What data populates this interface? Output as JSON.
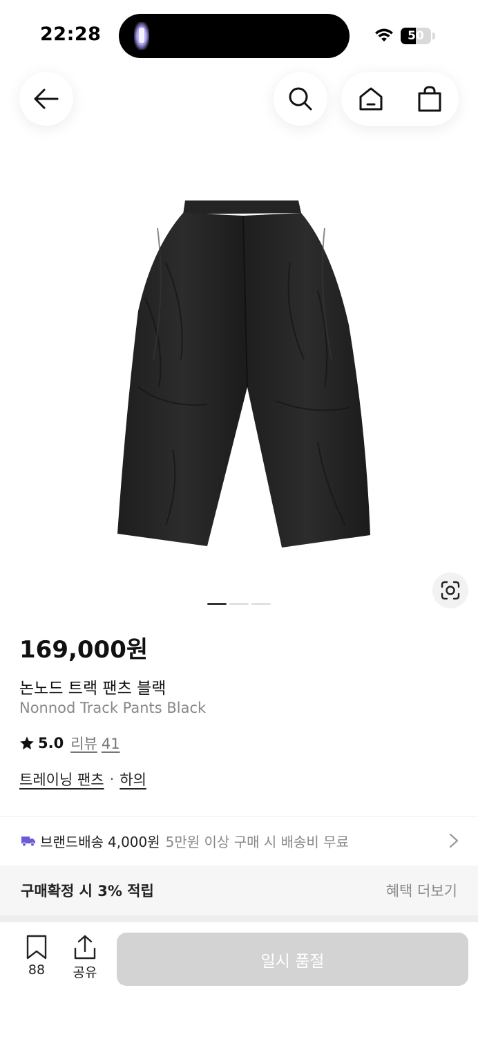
{
  "status_bar": {
    "time": "22:28",
    "battery_percent": "50",
    "battery_level": 0.5
  },
  "nav": {
    "back_icon": "arrow-left-icon",
    "search_icon": "search-icon",
    "home_icon": "home-icon",
    "cart_icon": "shopping-bag-icon"
  },
  "gallery": {
    "image_count": 3,
    "active_index": 0
  },
  "product": {
    "price": "169,000원",
    "name_ko": "논노드 트랙 팬츠 블랙",
    "name_en": "Nonnod Track Pants Black",
    "rating": "5.0",
    "review_label": "리뷰",
    "review_count": "41",
    "category": "트레이닝 팬츠",
    "category_separator": "·",
    "subcategory": "하의"
  },
  "shipping": {
    "label": "브랜드배송",
    "fee": "4,000원",
    "note": "5만원 이상 구매 시 배송비 무료"
  },
  "points": {
    "text": "구매확정 시 3% 적립",
    "more": "혜택 더보기"
  },
  "bottom_bar": {
    "bookmark_count": "88",
    "share_label": "공유",
    "buy_label": "일시 품절"
  },
  "colors": {
    "accent_truck": "#6b5bd6",
    "disabled_button": "#d3d3d3"
  }
}
